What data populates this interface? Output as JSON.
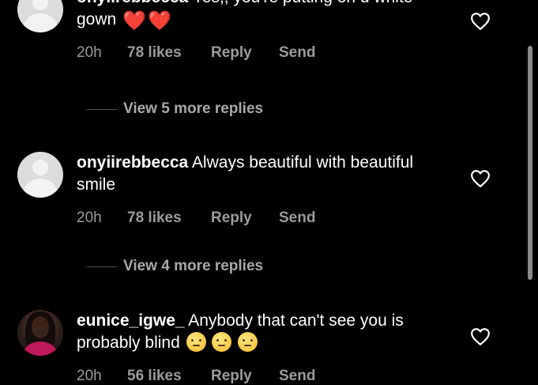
{
  "comments": [
    {
      "username": "onyiirebbecca",
      "text": "Yes,, you're putting on d white gown",
      "emoji": [
        "❤️",
        "❤️"
      ],
      "time": "20h",
      "likes": "78 likes",
      "reply": "Reply",
      "send": "Send",
      "view_more": "View 5 more replies"
    },
    {
      "username": "onyiirebbecca",
      "text": "Always beautiful with beautiful smile",
      "time": "20h",
      "likes": "78 likes",
      "reply": "Reply",
      "send": "Send",
      "view_more": "View 4 more replies"
    },
    {
      "username": "eunice_igwe_",
      "text": "Anybody that can't see you is probably blind",
      "emoji": [
        "😶",
        "😶",
        "😶"
      ],
      "time": "20h",
      "likes": "56 likes",
      "reply": "Reply",
      "send": "Send"
    }
  ],
  "colors": {
    "background": "#000000",
    "text": "#ffffff",
    "meta": "#9b9b9b",
    "heart": "#e8212e"
  },
  "icons": {
    "like": "heart-outline-icon",
    "avatar_default": "default-avatar-icon"
  }
}
